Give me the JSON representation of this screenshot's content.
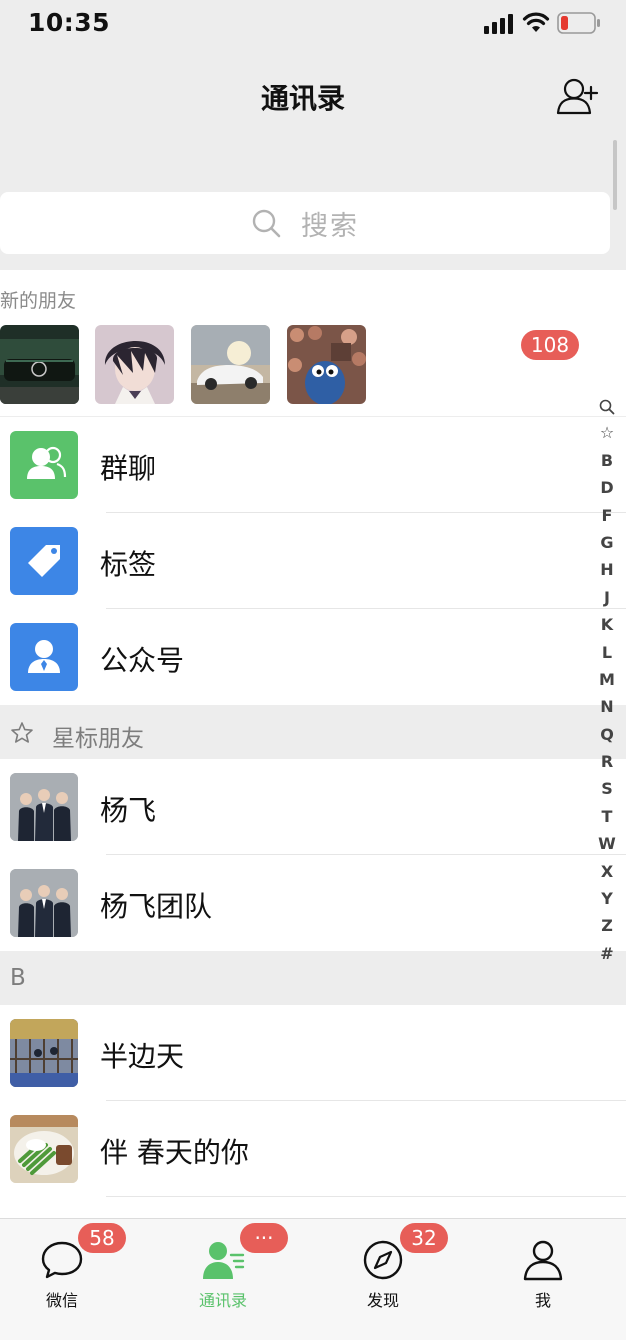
{
  "status_bar": {
    "time": "10:35"
  },
  "header": {
    "title": "通讯录"
  },
  "search": {
    "placeholder": "搜索"
  },
  "new_friends": {
    "title": "新的朋友",
    "badge": "108"
  },
  "functions": [
    {
      "label": "群聊",
      "icon": "group-chat-icon",
      "color": "#5ac26b"
    },
    {
      "label": "标签",
      "icon": "tag-icon",
      "color": "#3d86e6"
    },
    {
      "label": "公众号",
      "icon": "official-account-icon",
      "color": "#3d86e6"
    }
  ],
  "starred": {
    "header": "星标朋友",
    "contacts": [
      "杨飞",
      "杨飞团队"
    ]
  },
  "section_b": {
    "header": "B",
    "contacts": [
      "半边天",
      "伴 春天的你"
    ]
  },
  "index_letters": [
    "☆",
    "B",
    "D",
    "F",
    "G",
    "H",
    "J",
    "K",
    "L",
    "M",
    "N",
    "Q",
    "R",
    "S",
    "T",
    "W",
    "X",
    "Y",
    "Z",
    "#"
  ],
  "tabs": [
    {
      "label": "微信",
      "badge": "58",
      "icon": "chat-bubble-icon",
      "active": false
    },
    {
      "label": "通讯录",
      "badge": "···",
      "icon": "contacts-icon",
      "active": true
    },
    {
      "label": "发现",
      "badge": "32",
      "icon": "compass-icon",
      "active": false
    },
    {
      "label": "我",
      "badge": "",
      "icon": "person-icon",
      "active": false
    }
  ],
  "colors": {
    "accent": "#07c160",
    "badge": "#e75e58",
    "background": "#ededed"
  }
}
